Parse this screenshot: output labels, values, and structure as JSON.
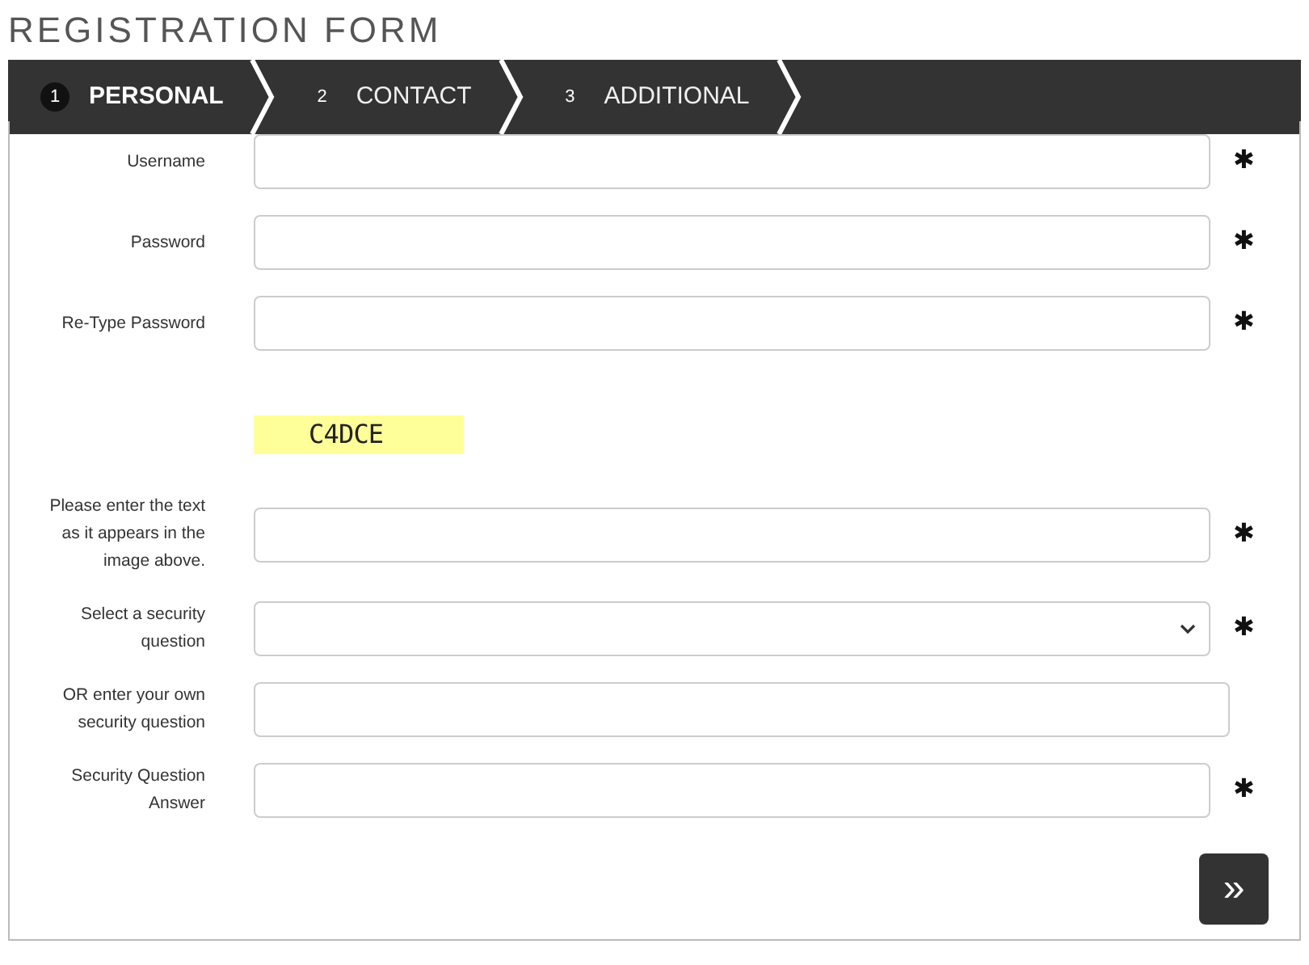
{
  "title": "REGISTRATION FORM",
  "steps": [
    {
      "number": "1",
      "label": "PERSONAL",
      "selected": true
    },
    {
      "number": "2",
      "label": "CONTACT",
      "selected": false
    },
    {
      "number": "3",
      "label": "ADDITIONAL",
      "selected": false
    }
  ],
  "fields": [
    {
      "kind": "input",
      "label": "Username",
      "required_mark": "✱"
    },
    {
      "kind": "input",
      "label": "Password",
      "required_mark": "✱"
    },
    {
      "kind": "input",
      "label": "Re-Type Password",
      "required_mark": "✱"
    },
    {
      "kind": "captcha",
      "code": "C4DCE"
    },
    {
      "kind": "input",
      "label": "Please enter the text as it appears in the image above.",
      "required_mark": "✱"
    },
    {
      "kind": "select",
      "label": "Select a security question",
      "required_mark": "✱"
    },
    {
      "kind": "input",
      "label": "OR enter your own security question"
    },
    {
      "kind": "input",
      "label": "Security Question Answer",
      "required_mark": "✱"
    }
  ],
  "next_button": "»"
}
